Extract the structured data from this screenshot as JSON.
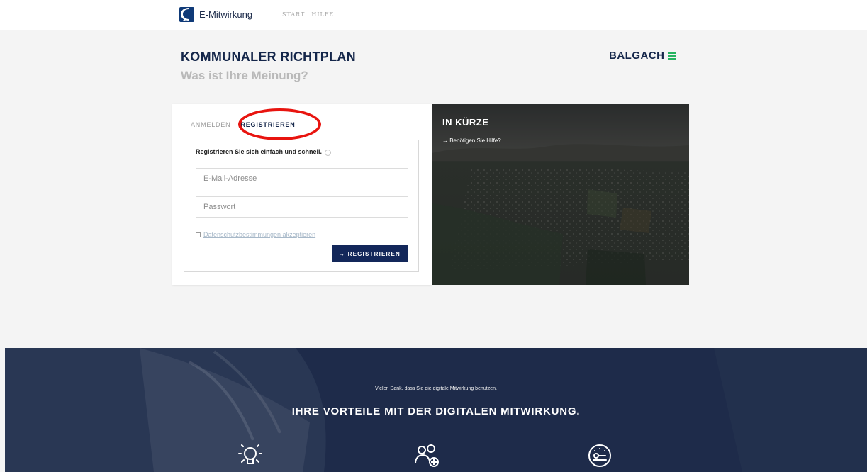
{
  "header": {
    "app_name": "E-Mitwirkung",
    "nav": [
      "START",
      "HILFE"
    ]
  },
  "project": {
    "title": "KOMMUNALER RICHTPLAN",
    "subtitle": "Was ist Ihre Meinung?",
    "municipality": "BALGACH",
    "accent_color": "#25b35f"
  },
  "auth": {
    "tabs": {
      "login": "ANMELDEN",
      "register": "REGISTRIEREN"
    },
    "active_tab": "register",
    "highlight_color": "#e8140f",
    "intro": "Registrieren Sie sich einfach und schnell.",
    "info_icon": "info-circle-icon",
    "email_placeholder": "E-Mail-Adresse",
    "password_placeholder": "Passwort",
    "consent_label": "Datenschutzbestimmungen akzeptieren",
    "consent_checked": false,
    "submit_label": "→ REGISTRIEREN"
  },
  "summary": {
    "heading": "IN KÜRZE",
    "help_link": "→ Benötigen Sie Hilfe?"
  },
  "benefits": {
    "thanks": "Vielen Dank, dass Sie die digitale Mitwirkung benutzen.",
    "title": "IHRE VORTEILE MIT DER DIGITALEN MITWIRKUNG.",
    "icons": [
      "lightbulb-icon",
      "users-add-icon",
      "gauge-icon"
    ],
    "background_color": "#1e2b4a"
  }
}
